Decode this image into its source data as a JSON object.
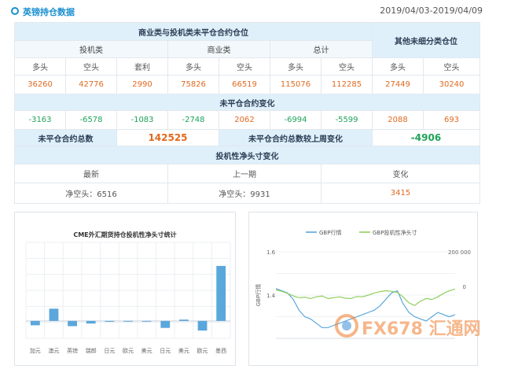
{
  "header": {
    "title": "英镑持仓数据",
    "date_range": "2019/04/03-2019/04/09"
  },
  "table": {
    "group_title": "商业类与投机类未平仓合约仓位",
    "other_title": "其他未细分类仓位",
    "speculative": "投机类",
    "commercial": "商业类",
    "total": "总计",
    "long": "多头",
    "short": "空头",
    "arbitrage": "套利",
    "positions": [
      "36260",
      "42776",
      "2990",
      "75826",
      "66519",
      "115076",
      "112285",
      "27449",
      "30240"
    ],
    "change_title": "未平仓合约变化",
    "changes": [
      "-3163",
      "-6578",
      "-1083",
      "-2748",
      "2062",
      "-6994",
      "-5599",
      "2088",
      "693"
    ],
    "oi_total_label": "未平仓合约总数",
    "oi_total_value": "142525",
    "oi_change_label": "未平仓合约总数较上周变化",
    "oi_change_value": "-4906",
    "net_title": "投机性净头寸变化",
    "latest": "最新",
    "previous": "上一期",
    "change": "变化",
    "latest_value": "净空头：6516",
    "previous_value": "净空头：9931",
    "change_value": "3415"
  },
  "chart_data": [
    {
      "type": "bar",
      "title": "CME外汇期货持仓投机性净头寸统计",
      "categories": [
        "加元",
        "澳元",
        "英镑",
        "瑞郎",
        "日元",
        "欧元",
        "美元",
        "日元",
        "美元",
        "欧元",
        "墨西"
      ],
      "values": [
        -0.5,
        1.4,
        -0.6,
        -0.3,
        -0.1,
        -0.05,
        -0.05,
        -0.8,
        0.15,
        -1.1,
        6.3
      ],
      "ylim": [
        -2,
        9
      ],
      "grid": true
    },
    {
      "type": "line",
      "legend": [
        "GBP行情",
        "GBP投机性净头寸"
      ],
      "legend_position": "top",
      "ylabel": "GBP行情",
      "left_ticks": [
        "1.6",
        "1.4"
      ],
      "right_ticks": [
        "200 000",
        "0"
      ],
      "ylim_left": [
        1.2,
        1.6
      ],
      "ylim_right": [
        -300000,
        200000
      ],
      "series": [
        {
          "name": "GBP行情",
          "color": "#5aa7dc",
          "axis": "left",
          "values": [
            1.43,
            1.42,
            1.41,
            1.38,
            1.33,
            1.3,
            1.29,
            1.27,
            1.25,
            1.25,
            1.26,
            1.27,
            1.28,
            1.29,
            1.3,
            1.31,
            1.32,
            1.33,
            1.35,
            1.38,
            1.41,
            1.42,
            1.36,
            1.32,
            1.3,
            1.29,
            1.28,
            1.3,
            1.32,
            1.31,
            1.3,
            1.31
          ]
        },
        {
          "name": "GBP投机性净头寸",
          "color": "#8fcf5e",
          "axis": "right",
          "values": [
            -20000,
            -28000,
            -40000,
            -55000,
            -65000,
            -62000,
            -70000,
            -60000,
            -55000,
            -70000,
            -65000,
            -60000,
            -68000,
            -70000,
            -58000,
            -60000,
            -50000,
            -38000,
            -30000,
            -25000,
            -28000,
            -35000,
            -60000,
            -95000,
            -110000,
            -85000,
            -70000,
            -75000,
            -60000,
            -40000,
            -25000,
            -15000
          ]
        }
      ]
    }
  ],
  "watermark": "FX678 汇通网",
  "colors": {
    "accent": "#1a8fd0",
    "header_bg": "#dff0fb",
    "positive": "#e06a20",
    "negative": "#1fa35a",
    "bar": "#5aa7dc"
  }
}
